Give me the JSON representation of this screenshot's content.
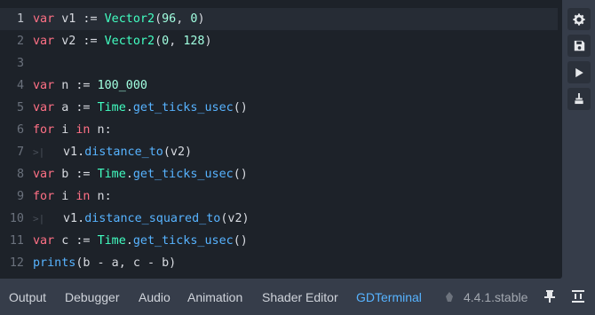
{
  "editor": {
    "lines": [
      {
        "n": "1",
        "tokens": [
          [
            "kw",
            "var"
          ],
          [
            "ident",
            " v1 := "
          ],
          [
            "ty",
            "Vector2"
          ],
          [
            "ident",
            "("
          ],
          [
            "num",
            "96"
          ],
          [
            "ident",
            ", "
          ],
          [
            "num",
            "0"
          ],
          [
            "ident",
            ")"
          ]
        ]
      },
      {
        "n": "2",
        "tokens": [
          [
            "kw",
            "var"
          ],
          [
            "ident",
            " v2 := "
          ],
          [
            "ty",
            "Vector2"
          ],
          [
            "ident",
            "("
          ],
          [
            "num",
            "0"
          ],
          [
            "ident",
            ", "
          ],
          [
            "num",
            "128"
          ],
          [
            "ident",
            ")"
          ]
        ]
      },
      {
        "n": "3",
        "tokens": []
      },
      {
        "n": "4",
        "tokens": [
          [
            "kw",
            "var"
          ],
          [
            "ident",
            " n := "
          ],
          [
            "num",
            "100_000"
          ]
        ]
      },
      {
        "n": "5",
        "tokens": [
          [
            "kw",
            "var"
          ],
          [
            "ident",
            " a := "
          ],
          [
            "ty",
            "Time"
          ],
          [
            "ident",
            "."
          ],
          [
            "fn",
            "get_ticks_usec"
          ],
          [
            "ident",
            "()"
          ]
        ]
      },
      {
        "n": "6",
        "tokens": [
          [
            "kw",
            "for"
          ],
          [
            "ident",
            " i "
          ],
          [
            "kw",
            "in"
          ],
          [
            "ident",
            " n:"
          ]
        ]
      },
      {
        "n": "7",
        "indent": true,
        "tokens": [
          [
            "ident",
            "v1."
          ],
          [
            "fn",
            "distance_to"
          ],
          [
            "ident",
            "(v2)"
          ]
        ]
      },
      {
        "n": "8",
        "tokens": [
          [
            "kw",
            "var"
          ],
          [
            "ident",
            " b := "
          ],
          [
            "ty",
            "Time"
          ],
          [
            "ident",
            "."
          ],
          [
            "fn",
            "get_ticks_usec"
          ],
          [
            "ident",
            "()"
          ]
        ]
      },
      {
        "n": "9",
        "tokens": [
          [
            "kw",
            "for"
          ],
          [
            "ident",
            " i "
          ],
          [
            "kw",
            "in"
          ],
          [
            "ident",
            " n:"
          ]
        ]
      },
      {
        "n": "10",
        "indent": true,
        "tokens": [
          [
            "ident",
            "v1."
          ],
          [
            "fn",
            "distance_squared_to"
          ],
          [
            "ident",
            "(v2)"
          ]
        ]
      },
      {
        "n": "11",
        "tokens": [
          [
            "kw",
            "var"
          ],
          [
            "ident",
            " c := "
          ],
          [
            "ty",
            "Time"
          ],
          [
            "ident",
            "."
          ],
          [
            "fn",
            "get_ticks_usec"
          ],
          [
            "ident",
            "()"
          ]
        ]
      },
      {
        "n": "12",
        "tokens": [
          [
            "fn",
            "prints"
          ],
          [
            "ident",
            "(b - a, c - b)"
          ]
        ]
      }
    ]
  },
  "toolbar": {
    "settings_icon": "gear-icon",
    "save_icon": "save-icon",
    "run_icon": "play-icon",
    "clear_icon": "broom-icon"
  },
  "bottom_tabs": {
    "output": "Output",
    "debugger": "Debugger",
    "audio": "Audio",
    "animation": "Animation",
    "shader_editor": "Shader Editor",
    "gdterminal": "GDTerminal"
  },
  "version": "4.4.1.stable",
  "colors": {
    "keyword": "#ff7085",
    "function": "#57b3ff",
    "type": "#42ffc2",
    "number": "#a1ffe0",
    "active_tab": "#57b3ff"
  }
}
